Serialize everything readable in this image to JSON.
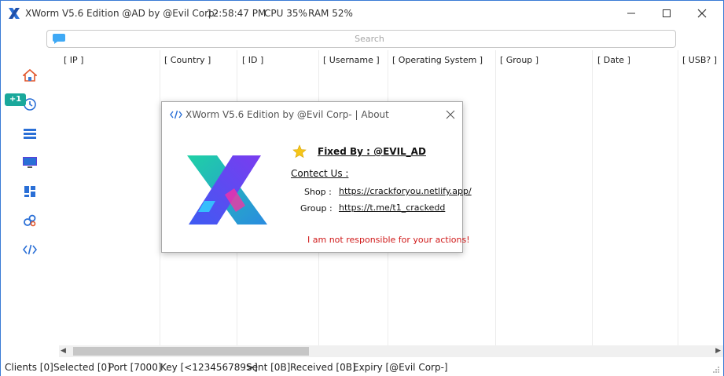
{
  "titlebar": {
    "title": "XWorm V5.6 Edition @AD by @Evil Corp-",
    "time": "12:58:47 PM",
    "cpu": "CPU 35%",
    "ram": "RAM 52%"
  },
  "search": {
    "placeholder": "Search"
  },
  "sidebar": {
    "badge": "+1",
    "items": [
      "home-icon",
      "history-icon",
      "list-icon",
      "monitor-icon",
      "dashboard-icon",
      "settings-icon",
      "code-icon"
    ]
  },
  "table": {
    "columns": [
      "[ IP ]",
      "[ Country ]",
      "[ ID ]",
      "[ Username ]",
      "[ Operating System ]",
      "[ Group ]",
      "[ Date ]",
      "[ USB? ]"
    ]
  },
  "statusbar": {
    "clients": "Clients [0]",
    "selected": "Selected [0]",
    "port": "Port [7000]",
    "key": "Key [<123456789>]",
    "sent": "Sent [0B]",
    "received": "Received [0B]",
    "expiry": "Expiry [@Evil Corp-]"
  },
  "about": {
    "title": "XWorm V5.6 Edition by @Evil Corp- | About",
    "fixed_by": "Fixed By : @EVIL_AD",
    "contact": "Contect Us :",
    "shop_label": "Shop :",
    "shop_link": "https://crackforyou.netlify.app/",
    "group_label": "Group :",
    "group_link": "https://t.me/t1_crackedd",
    "disclaimer": "I am not responsible for your actions!"
  },
  "colors": {
    "accent": "#3a7bd5",
    "badge": "#1aa89b",
    "disclaimer": "#d01919"
  }
}
